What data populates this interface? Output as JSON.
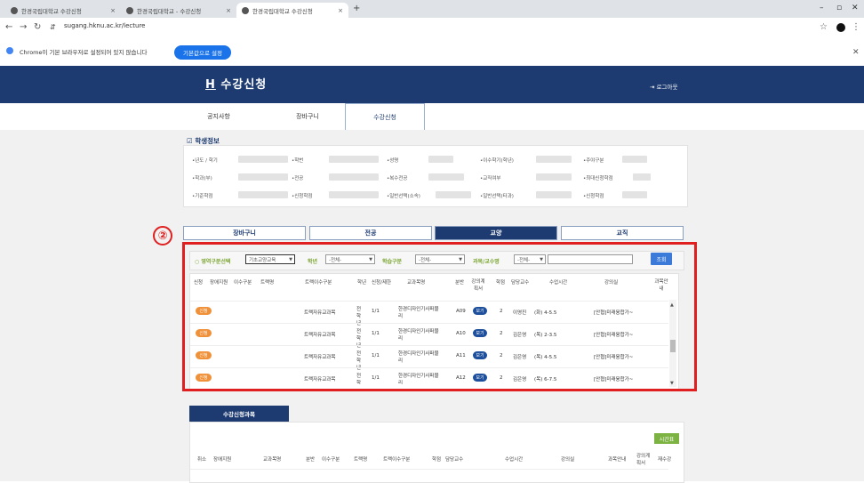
{
  "browser": {
    "tabs": [
      {
        "title": "한경국립대학교 수강신청"
      },
      {
        "title": "한경국립대학교 - 수강신청"
      },
      {
        "title": "한경국립대학교 수강신청"
      }
    ],
    "url": "sugang.hknu.ac.kr/lecture",
    "infobar_text": "Chrome이 기본 브라우저로 설정되어 있지 않습니다",
    "infobar_button": "기본값으로 설정"
  },
  "site": {
    "logo_mark": "H",
    "title": "수강신청",
    "logout": "로그아웃",
    "nav": [
      "공지사항",
      "장바구니",
      "수강신청"
    ],
    "active_nav": "수강신청"
  },
  "student": {
    "section_title": "학생정보",
    "labels": [
      "•년도 / 학기",
      "•학번",
      "•성명",
      "•이수학기(학년)",
      "•주야구분",
      "•학과(부)",
      "•전공",
      "•복수전공",
      "•교직여부",
      "•최대신청학점",
      "•기준학점",
      "•신청학점",
      "•일반선택(소속)",
      "•일반선택(타과)",
      "•신청학점"
    ]
  },
  "section_tabs": [
    "장바구니",
    "전공",
    "교양",
    "교직"
  ],
  "active_section": "교양",
  "annotation_marker": "②",
  "filters": {
    "area_label": "영역구분선택",
    "area_value": "기초교양교육",
    "grade_label": "학년",
    "grade_value": "-전체-",
    "type_label": "학습구분",
    "type_value": "-전체-",
    "subject_label": "과목/교수명",
    "subject_value": "-전체-",
    "search_button": "조회"
  },
  "table": {
    "headers": [
      "신청",
      "장애지원",
      "이수구분",
      "트랙명",
      "트랙이수구분",
      "학년",
      "신청/제한",
      "교과목명",
      "분반",
      "강의계획서",
      "학점",
      "담당교수",
      "수업시간",
      "강의실",
      "과목안내"
    ],
    "rows": [
      {
        "apply": "신청",
        "track_type": "트랙자유교과목",
        "grade": "전학년",
        "count": "1/1",
        "course": "한경디자인기사퍼블리",
        "section": "A09",
        "plan": "보기",
        "credit": "2",
        "prof": "이영진",
        "time": "(화) 4-5.5",
        "room": "[안협]미래융합가~"
      },
      {
        "apply": "신청",
        "track_type": "트랙자유교과목",
        "grade": "전학년",
        "count": "1/1",
        "course": "한경디자인기사퍼블리",
        "section": "A10",
        "plan": "보기",
        "credit": "2",
        "prof": "김은영",
        "time": "(목) 2-3.5",
        "room": "[안협]미래융합가~"
      },
      {
        "apply": "신청",
        "track_type": "트랙자유교과목",
        "grade": "전학년",
        "count": "1/1",
        "course": "한경디자인기사퍼블리",
        "section": "A11",
        "plan": "보기",
        "credit": "2",
        "prof": "김은영",
        "time": "(목) 4-5.5",
        "room": "[안협]미래융합가~"
      },
      {
        "apply": "신청",
        "track_type": "트랙자유교과목",
        "grade": "전학년",
        "count": "1/1",
        "course": "한경디자인기사퍼블리",
        "section": "A12",
        "plan": "보기",
        "credit": "2",
        "prof": "김은영",
        "time": "(목) 6-7.5",
        "room": "[안협]미래융합가~"
      }
    ]
  },
  "bottom": {
    "title": "수강신청과목",
    "timetable_button": "시간표",
    "headers": [
      "취소",
      "장애지원",
      "교과목명",
      "분반",
      "이수구분",
      "트랙명",
      "트랙이수구분",
      "학점",
      "담당교수",
      "수업시간",
      "강의실",
      "과목안내",
      "강의계획서",
      "재수강"
    ]
  },
  "colors": {
    "header": "#1d3b70",
    "highlight": "#e02020",
    "apply": "#f0913a",
    "view": "#1d4f9c",
    "accent": "#7aa530"
  }
}
